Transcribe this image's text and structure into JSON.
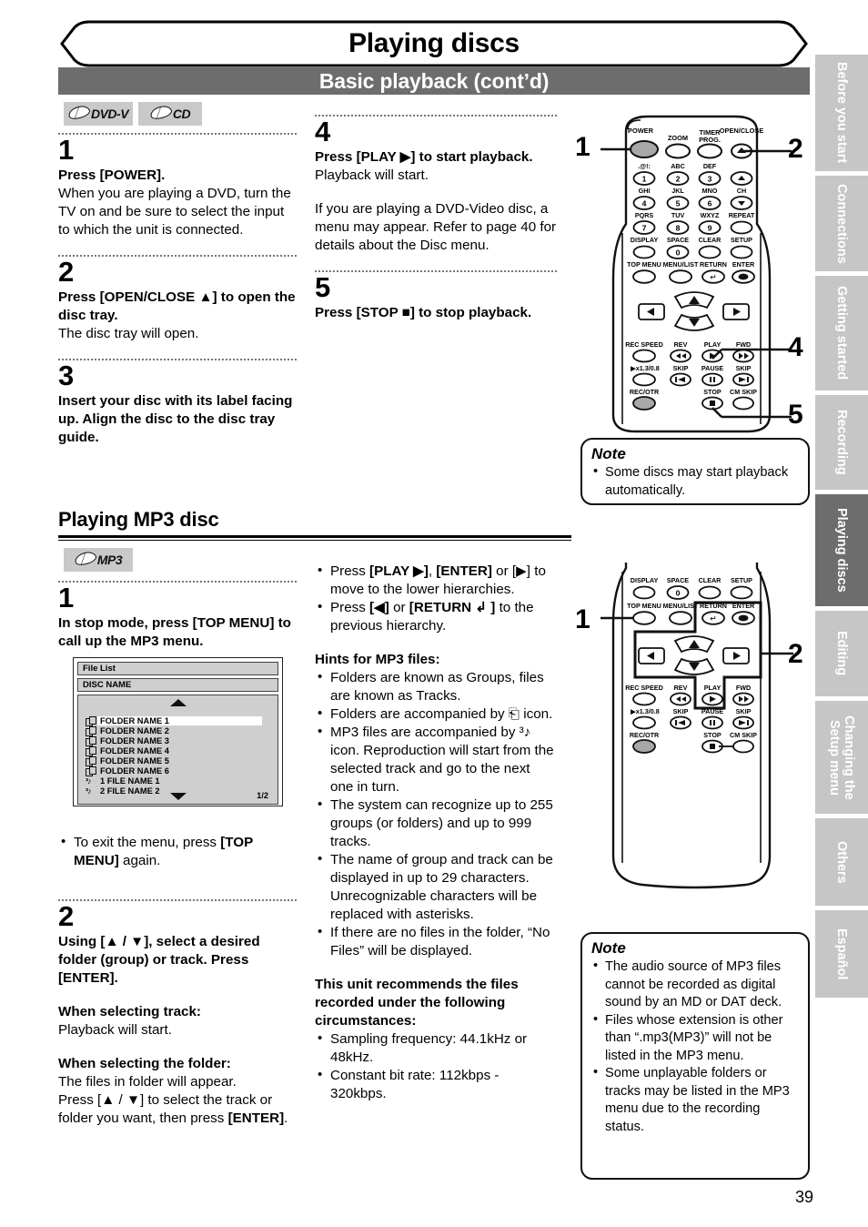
{
  "header": {
    "title": "Playing discs",
    "subtitle": "Basic playback (cont’d)"
  },
  "badges": {
    "dvdv": "DVD-V",
    "cd": "CD",
    "mp3": "MP3"
  },
  "basic_playback": {
    "steps": [
      {
        "num": "1",
        "bold": "Press [POWER].",
        "body": "When you are playing a DVD, turn the TV on and be sure to select the input to which the unit is connected."
      },
      {
        "num": "2",
        "bold": "Press [OPEN/CLOSE ▲] to open the disc tray.",
        "body": "The disc tray will open."
      },
      {
        "num": "3",
        "bold": "Insert your disc with its label facing up. Align the disc to the disc tray guide.",
        "body": ""
      },
      {
        "num": "4",
        "bold": "Press [PLAY ▶] to start playback.",
        "body": "Playback will start.",
        "body2": "If you are playing a DVD-Video disc, a menu may appear. Refer to page 40 for details about the Disc menu."
      },
      {
        "num": "5",
        "bold": "Press [STOP ■] to stop playback.",
        "body": ""
      }
    ]
  },
  "note_top": {
    "title": "Note",
    "items": [
      "Some discs may start playback automatically."
    ]
  },
  "mp3_section": {
    "heading": "Playing MP3 disc",
    "step1": {
      "num": "1",
      "bold": "In stop mode, press [TOP MENU] to call up the MP3 menu."
    },
    "step1_bullet_pre": "To exit the menu, press ",
    "step1_bullet_bold": "[TOP MENU]",
    "step1_bullet_post": " again.",
    "step2": {
      "num": "2",
      "bold": "Using [▲ / ▼], select a desired folder (group) or track. Press [ENTER].",
      "track_head": "When selecting track:",
      "track_body": "Playback will start.",
      "folder_head": "When selecting the folder:",
      "folder_body_1": "The files in folder will appear.",
      "folder_body_2": "Press [▲ / ▼] to select the track or folder you want, then press ",
      "folder_body_3": "[ENTER]",
      "folder_body_4": "."
    }
  },
  "osd": {
    "file_list_label": "File List",
    "disc_name_label": "DISC NAME",
    "page_indicator": "1/2",
    "rows": [
      {
        "icon": "folder-icon",
        "label": "FOLDER NAME 1",
        "selected": true
      },
      {
        "icon": "folder-icon",
        "label": "FOLDER NAME 2",
        "selected": false
      },
      {
        "icon": "folder-icon",
        "label": "FOLDER NAME 3",
        "selected": false
      },
      {
        "icon": "folder-icon",
        "label": "FOLDER NAME 4",
        "selected": false
      },
      {
        "icon": "folder-icon",
        "label": "FOLDER NAME 5",
        "selected": false
      },
      {
        "icon": "folder-icon",
        "label": "FOLDER NAME 6",
        "selected": false
      },
      {
        "icon": "mp3-note-icon",
        "label": "1 FILE NAME 1",
        "selected": false
      },
      {
        "icon": "mp3-note-icon",
        "label": "2 FILE NAME 2",
        "selected": false
      }
    ]
  },
  "mid_column": {
    "nav_bullets": [
      {
        "pre": "Press ",
        "b1": "[PLAY ▶]",
        "mid": ", ",
        "b2": "[ENTER]",
        "post": " or [▶] to move to the lower hierarchies."
      },
      {
        "pre": "Press ",
        "b1": "[◀]",
        "mid": " or ",
        "b2": "[RETURN ↲ ]",
        "post": " to the previous hierarchy."
      }
    ],
    "hints_head": "Hints for MP3 files:",
    "hints": [
      "Folders are known as Groups, files are known as Tracks.",
      "Folders are accompanied by ⎗ icon.",
      "MP3 files are accompanied by ³♪ icon. Reproduction will start from the selected track and go to the next one in turn.",
      "The system can recognize up to 255 groups (or folders) and up to 999 tracks.",
      "The name of group and track can be displayed in up to 29 characters. Unrecognizable characters will be replaced with asterisks.",
      "If there are no files in the folder, “No Files” will be displayed."
    ],
    "recommend_head": "This unit recommends the files recorded under the following circumstances:",
    "recommend": [
      "Sampling frequency: 44.1kHz or 48kHz.",
      "Constant bit rate: 112kbps - 320kbps."
    ]
  },
  "note_bottom": {
    "title": "Note",
    "items": [
      "The audio source of MP3 files cannot be recorded as digital sound by an MD or DAT deck.",
      "Files whose extension is other than “.mp3(MP3)” will not be listed in the MP3 menu.",
      "Some unplayable folders or tracks may be listed in the MP3 menu due to the recording status."
    ]
  },
  "remote_top": {
    "callouts": [
      "1",
      "2",
      "4",
      "5"
    ],
    "labels": [
      "POWER",
      "ZOOM",
      "TIMER\nPROG.",
      "OPEN/CLOSE",
      ".@!:",
      "ABC",
      "DEF",
      "GHI",
      "JKL",
      "MNO",
      "CH",
      "PQRS",
      "TUV",
      "WXYZ",
      "REPEAT",
      "DISPLAY",
      "SPACE",
      "CLEAR",
      "SETUP",
      "TOP MENU",
      "MENU/LIST",
      "RETURN",
      "ENTER",
      "REC SPEED",
      "REV",
      "PLAY",
      "FWD",
      "▶x1.3/0.8",
      "SKIP",
      "PAUSE",
      "SKIP",
      "REC/OTR",
      "STOP",
      "CM SKIP"
    ],
    "keys": [
      "1",
      "2",
      "3",
      "4",
      "5",
      "6",
      "7",
      "8",
      "9",
      "0"
    ]
  },
  "remote_bottom": {
    "callouts": [
      "1",
      "2"
    ],
    "labels": [
      "DISPLAY",
      "SPACE",
      "CLEAR",
      "SETUP",
      "TOP MENU",
      "MENU/LIST",
      "RETURN",
      "ENTER",
      "REC SPEED",
      "REV",
      "PLAY",
      "FWD",
      "▶x1.3/0.8",
      "SKIP",
      "PAUSE",
      "SKIP",
      "REC/OTR",
      "STOP",
      "CM SKIP"
    ]
  },
  "rail": {
    "tabs": [
      {
        "label": "Before you start",
        "active": false
      },
      {
        "label": "Connections",
        "active": false
      },
      {
        "label": "Getting started",
        "active": false
      },
      {
        "label": "Recording",
        "active": false
      },
      {
        "label": "Playing discs",
        "active": true
      },
      {
        "label": "Editing",
        "active": false
      },
      {
        "label": "Changing the\nSetup menu",
        "active": false
      },
      {
        "label": "Others",
        "active": false
      },
      {
        "label": "Español",
        "active": false
      }
    ]
  },
  "footer": {
    "page_number": "39"
  },
  "colors": {
    "banner_gray": "#6d6d6d",
    "tab_gray": "#c6c6c6",
    "badge_gray": "#c9c9c9",
    "osd_gray": "#cfcfcf"
  }
}
